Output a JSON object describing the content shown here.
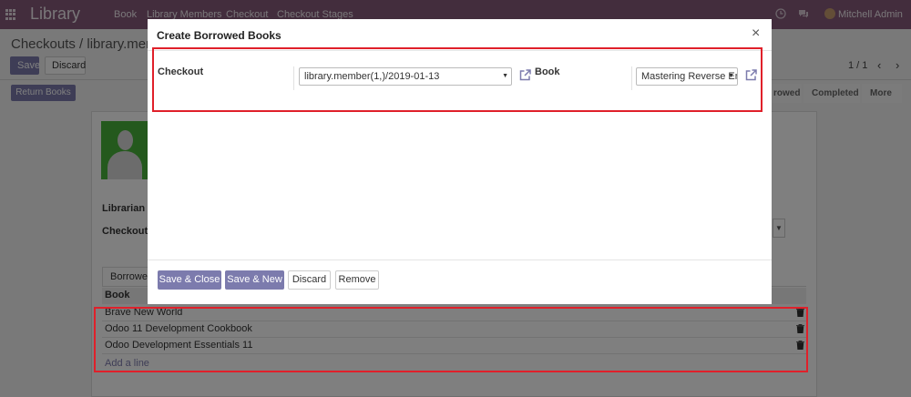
{
  "navbar": {
    "app_name": "Library",
    "menu": [
      "Book",
      "Library Members",
      "Checkout",
      "Checkout Stages"
    ],
    "user_name": "Mitchell Admin"
  },
  "control_panel": {
    "breadcrumb": "Checkouts / library.mem",
    "save_label": "Save",
    "discard_label": "Discard",
    "pager": "1 / 1",
    "return_books_label": "Return Books",
    "stages": [
      "rowed",
      "Completed",
      "More"
    ]
  },
  "form": {
    "librarian_label": "Librarian",
    "checkout_date_label": "Checkout D",
    "tab_label": "Borrowed Books",
    "column_book": "Book",
    "lines": [
      "Brave New World",
      "Odoo 11 Development Cookbook",
      "Odoo Development Essentials 11"
    ],
    "add_line": "Add a line"
  },
  "modal": {
    "title": "Create Borrowed Books",
    "close": "×",
    "checkout_label": "Checkout",
    "checkout_value": "library.member(1,)/2019-01-13",
    "book_label": "Book",
    "book_value": "Mastering Reverse Eng",
    "buttons": {
      "save_close": "Save & Close",
      "save_new": "Save & New",
      "discard": "Discard",
      "remove": "Remove"
    }
  },
  "colors": {
    "navbar": "#875a7b",
    "primary": "#7c7bad",
    "highlight": "#e0202a"
  }
}
